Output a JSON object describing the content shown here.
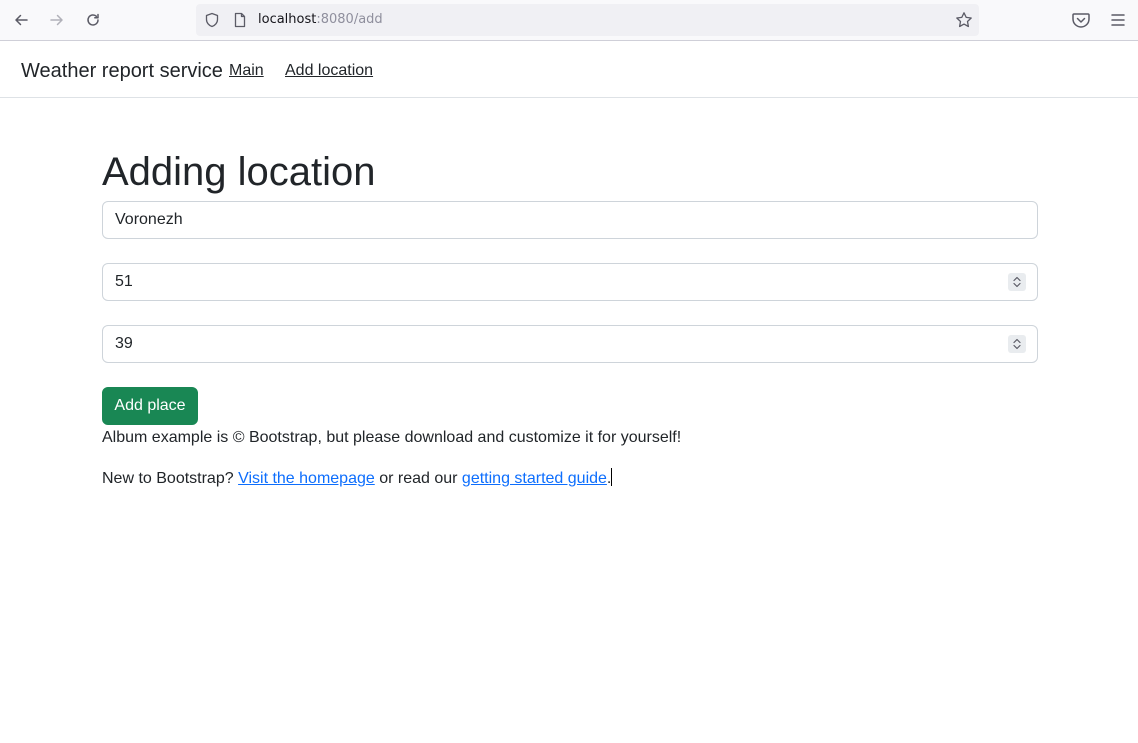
{
  "browser": {
    "url_host": "localhost",
    "url_rest": ":8080/add",
    "icons": {
      "back": "arrow-left-icon",
      "forward": "arrow-right-icon",
      "reload": "reload-icon",
      "shield": "shield-icon",
      "page": "page-icon",
      "bookmark": "star-icon",
      "pocket": "pocket-icon",
      "menu": "hamburger-menu-icon"
    }
  },
  "navbar": {
    "brand": "Weather report service",
    "links": [
      {
        "label": "Main"
      },
      {
        "label": "Add location"
      }
    ]
  },
  "main": {
    "title": "Adding location",
    "form": {
      "name_value": "Voronezh",
      "latitude_value": "51",
      "longitude_value": "39",
      "submit_label": "Add place"
    },
    "footer": {
      "line1": "Album example is © Bootstrap, but please download and customize it for yourself!",
      "line2_prefix": "New to Bootstrap? ",
      "link_homepage": "Visit the homepage",
      "line2_middle": " or read our ",
      "link_guide": "getting started guide",
      "line2_suffix": "."
    }
  },
  "colors": {
    "primary_button": "#198754",
    "link": "#0d6efd",
    "text": "#212529",
    "border": "#ced4da"
  }
}
